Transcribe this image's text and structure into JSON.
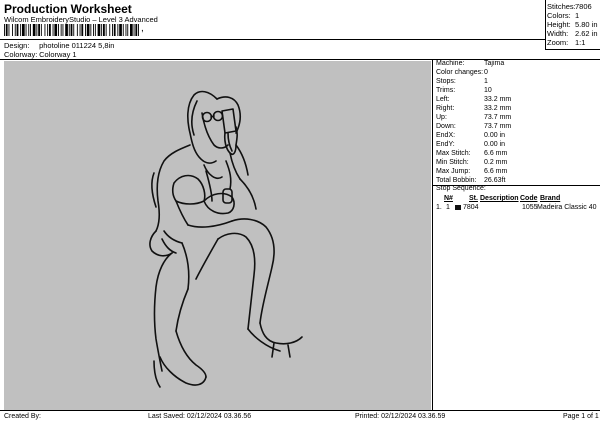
{
  "header": {
    "title": "Production Worksheet",
    "subtitle": "Wilcom EmbroideryStudio – Level 3 Advanced",
    "design_label": "Design:",
    "design_value": "photoline 011224 5,8in",
    "colorway_label": "Colorway:",
    "colorway_value": "Colorway 1"
  },
  "summary": [
    {
      "label": "Stitches:",
      "value": "7806"
    },
    {
      "label": "Colors:",
      "value": "1"
    },
    {
      "label": "Height:",
      "value": "5.80 in"
    },
    {
      "label": "Width:",
      "value": "2.62 in"
    },
    {
      "label": "Zoom:",
      "value": "1:1"
    }
  ],
  "machine_info": [
    {
      "label": "Machine:",
      "value": "Tajima"
    },
    {
      "label": "Color changes:",
      "value": "0"
    },
    {
      "label": "Stops:",
      "value": "1"
    },
    {
      "label": "Trims:",
      "value": "10"
    },
    {
      "label": "Left:",
      "value": "33.2 mm"
    },
    {
      "label": "Right:",
      "value": "33.2 mm"
    },
    {
      "label": "Up:",
      "value": "73.7 mm"
    },
    {
      "label": "Down:",
      "value": "73.7 mm"
    },
    {
      "label": "EndX:",
      "value": "0.00 in"
    },
    {
      "label": "EndY:",
      "value": "0.00 in"
    },
    {
      "label": "Max Stitch:",
      "value": "6.6 mm"
    },
    {
      "label": "Min Stitch:",
      "value": "0.2 mm"
    },
    {
      "label": "Max Jump:",
      "value": "6.6 mm"
    },
    {
      "label": "Total Bobbin:",
      "value": "26.63ft"
    }
  ],
  "stop_sequence": {
    "title": "Stop Sequence:",
    "columns": [
      "N#",
      "St.",
      "Description",
      "Code",
      "Brand"
    ],
    "rows": [
      {
        "index": "1.",
        "needle": "1",
        "stitches": "7804",
        "description": "",
        "code": "1055",
        "brand": "Madeira Classic 40",
        "color": "#111111"
      }
    ]
  },
  "footer": {
    "created_by": "Created By:",
    "last_saved": "Last Saved: 02/12/2024 03.36.56",
    "printed": "Printed: 02/12/2024 03.36.59",
    "page": "Page 1 of 1"
  },
  "colors": {
    "canvas_bg": "#c0c0c0",
    "thread": "#111111"
  }
}
